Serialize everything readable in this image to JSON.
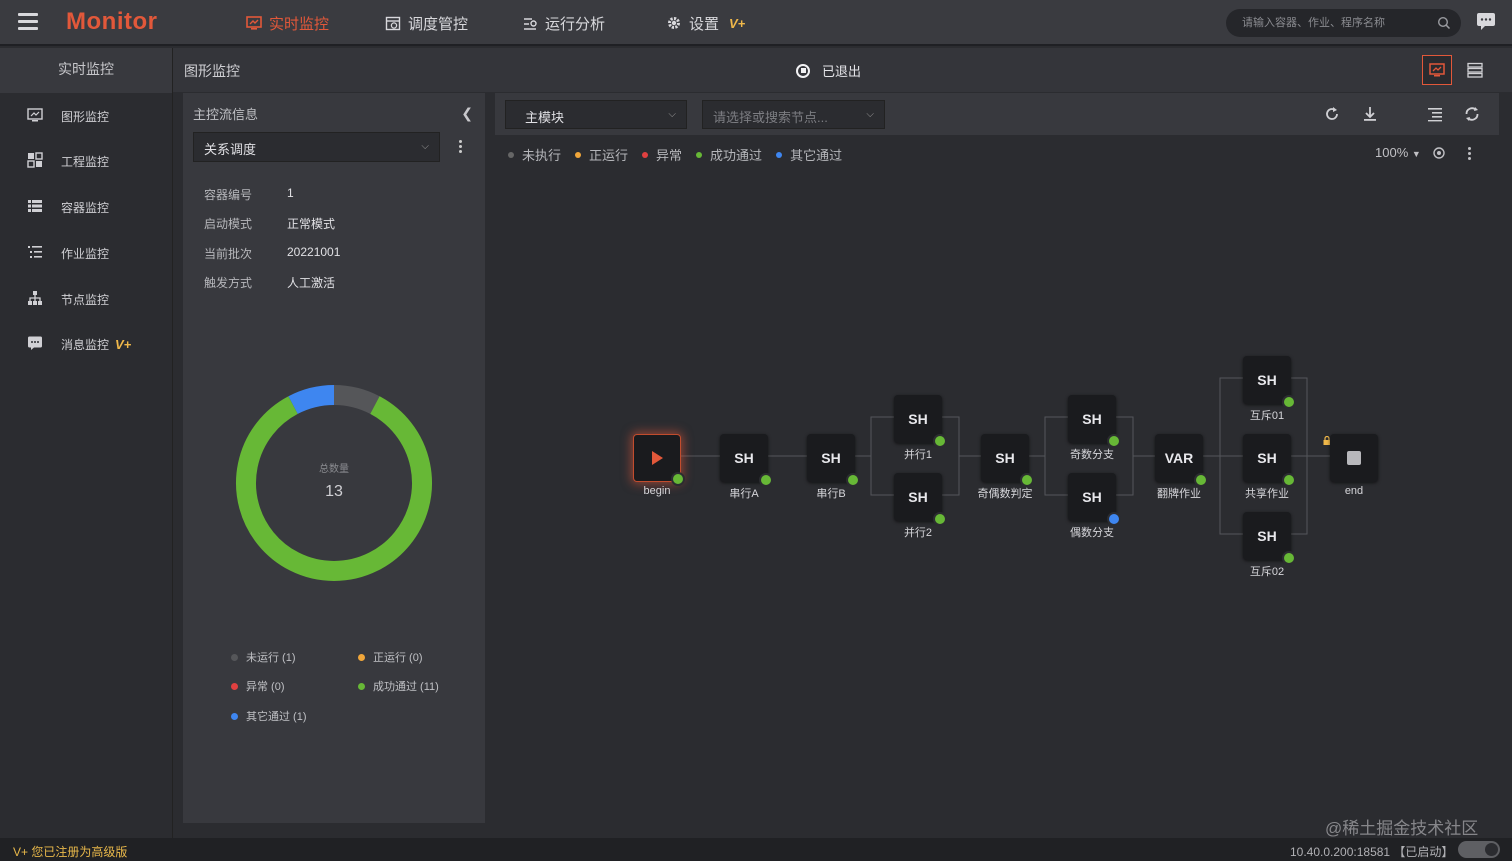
{
  "app": {
    "logo": "Monitor"
  },
  "topnav": [
    {
      "label": "实时监控",
      "icon": "monitor-alert-icon",
      "active": true
    },
    {
      "label": "调度管控",
      "icon": "schedule-icon",
      "active": false
    },
    {
      "label": "运行分析",
      "icon": "analysis-icon",
      "active": false
    },
    {
      "label": "设置",
      "icon": "gear-icon",
      "active": false,
      "badge": "V+"
    }
  ],
  "search": {
    "placeholder": "请输入容器、作业、程序名称"
  },
  "sidebar": {
    "header": "实时监控",
    "items": [
      {
        "label": "图形监控",
        "icon": "monitor-icon"
      },
      {
        "label": "工程监控",
        "icon": "grid-icon"
      },
      {
        "label": "容器监控",
        "icon": "list-icon"
      },
      {
        "label": "作业监控",
        "icon": "task-list-icon"
      },
      {
        "label": "节点监控",
        "icon": "hierarchy-icon"
      },
      {
        "label": "消息监控",
        "icon": "message-icon",
        "badge": "V+"
      }
    ]
  },
  "subheader": {
    "title": "图形监控",
    "status": "已退出"
  },
  "left_panel": {
    "title": "主控流信息",
    "select_value": "关系调度",
    "info": [
      {
        "key": "容器编号",
        "value": "1"
      },
      {
        "key": "启动模式",
        "value": "正常模式"
      },
      {
        "key": "当前批次",
        "value": "20221001"
      },
      {
        "key": "触发方式",
        "value": "人工激活"
      }
    ],
    "donut": {
      "label": "总数量",
      "total": "13"
    },
    "legend": [
      {
        "label": "未运行 (1)",
        "color": "#555659"
      },
      {
        "label": "正运行 (0)",
        "color": "#f0a63a"
      },
      {
        "label": "异常 (0)",
        "color": "#e04040"
      },
      {
        "label": "成功通过 (11)",
        "color": "#67b836"
      },
      {
        "label": "其它通过 (1)",
        "color": "#3e86f0"
      }
    ]
  },
  "chart_data": {
    "type": "pie",
    "title": "",
    "categories": [
      "未运行",
      "正运行",
      "异常",
      "成功通过",
      "其它通过"
    ],
    "values": [
      1,
      0,
      0,
      11,
      1
    ],
    "colors": [
      "#555659",
      "#f0a63a",
      "#e04040",
      "#67b836",
      "#3e86f0"
    ]
  },
  "canvas": {
    "module_select": "主模块",
    "node_search_placeholder": "请选择或搜索节点...",
    "legend": [
      {
        "label": "未执行",
        "color": "#666"
      },
      {
        "label": "正运行",
        "color": "#f0a63a"
      },
      {
        "label": "异常",
        "color": "#e04040"
      },
      {
        "label": "成功通过",
        "color": "#67b836"
      },
      {
        "label": "其它通过",
        "color": "#3e86f0"
      }
    ],
    "zoom": "100%",
    "nodes": [
      {
        "id": "begin",
        "text": "",
        "label": "begin",
        "status": "#67b836"
      },
      {
        "id": "sa",
        "text": "SH",
        "label": "串行A",
        "status": "#67b836"
      },
      {
        "id": "sb",
        "text": "SH",
        "label": "串行B",
        "status": "#67b836"
      },
      {
        "id": "p1",
        "text": "SH",
        "label": "并行1",
        "status": "#67b836"
      },
      {
        "id": "p2",
        "text": "SH",
        "label": "并行2",
        "status": "#67b836"
      },
      {
        "id": "oe",
        "text": "SH",
        "label": "奇偶数判定",
        "status": "#67b836"
      },
      {
        "id": "odd",
        "text": "SH",
        "label": "奇数分支",
        "status": "#67b836"
      },
      {
        "id": "even",
        "text": "SH",
        "label": "偶数分支",
        "status": "#3e86f0"
      },
      {
        "id": "var",
        "text": "VAR",
        "label": "翻牌作业",
        "status": "#67b836"
      },
      {
        "id": "m1",
        "text": "SH",
        "label": "互斥01",
        "status": "#67b836"
      },
      {
        "id": "sh",
        "text": "SH",
        "label": "共享作业",
        "status": "#67b836"
      },
      {
        "id": "m2",
        "text": "SH",
        "label": "互斥02",
        "status": "#67b836"
      },
      {
        "id": "end",
        "text": "",
        "label": "end",
        "status": ""
      }
    ]
  },
  "footer": {
    "license": "V+ 您已注册为高级版",
    "server": "10.40.0.200:18581 【已启动】"
  },
  "watermark": "@稀土掘金技术社区",
  "colors": {
    "accent": "#e2583a",
    "vplus": "#f0b84a",
    "success": "#67b836",
    "other": "#3e86f0",
    "idle": "#555659"
  }
}
